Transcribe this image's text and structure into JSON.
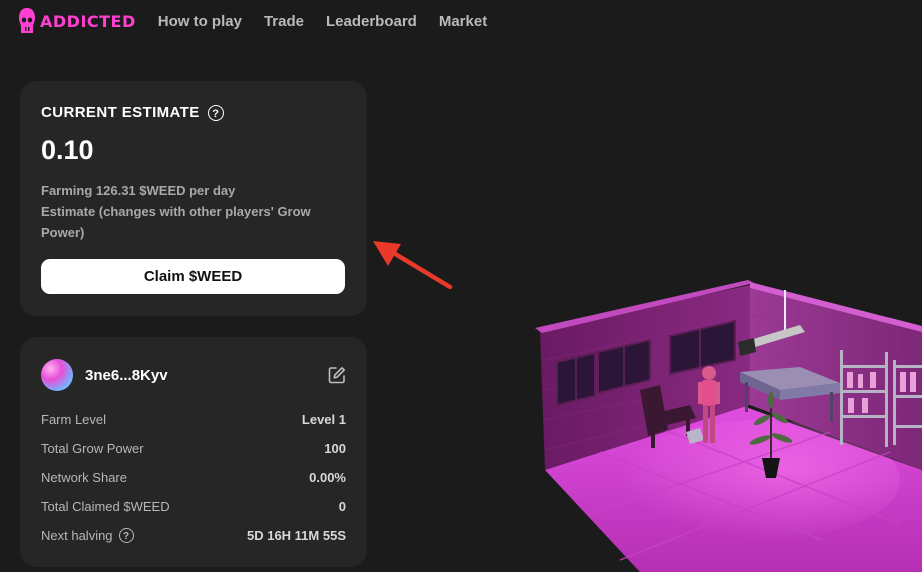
{
  "nav": {
    "logo_text": "ADDICTED",
    "links": [
      "How to play",
      "Trade",
      "Leaderboard",
      "Market"
    ]
  },
  "estimate": {
    "title": "CURRENT ESTIMATE",
    "value": "0.10",
    "farming_text": "Farming 126.31 $WEED per day",
    "estimate_note": "Estimate (changes with other players' Grow Power)",
    "claim_label": "Claim $WEED"
  },
  "farm": {
    "user": "3ne6...8Kyv",
    "stats": [
      {
        "label": "Farm Level",
        "value": "Level 1"
      },
      {
        "label": "Total Grow Power",
        "value": "100"
      },
      {
        "label": "Network Share",
        "value": "0.00%"
      },
      {
        "label": "Total Claimed $WEED",
        "value": "0"
      },
      {
        "label": "Next halving",
        "value": "5D 16H 11M 55S"
      }
    ]
  },
  "icons": [
    "skull-logo-icon",
    "help-icon",
    "edit-icon",
    "arrow-annotation"
  ],
  "colors": {
    "background": "#1b1b1b",
    "card": "#262626",
    "brand": "#ff3fd0",
    "annotation": "#e8392a"
  }
}
